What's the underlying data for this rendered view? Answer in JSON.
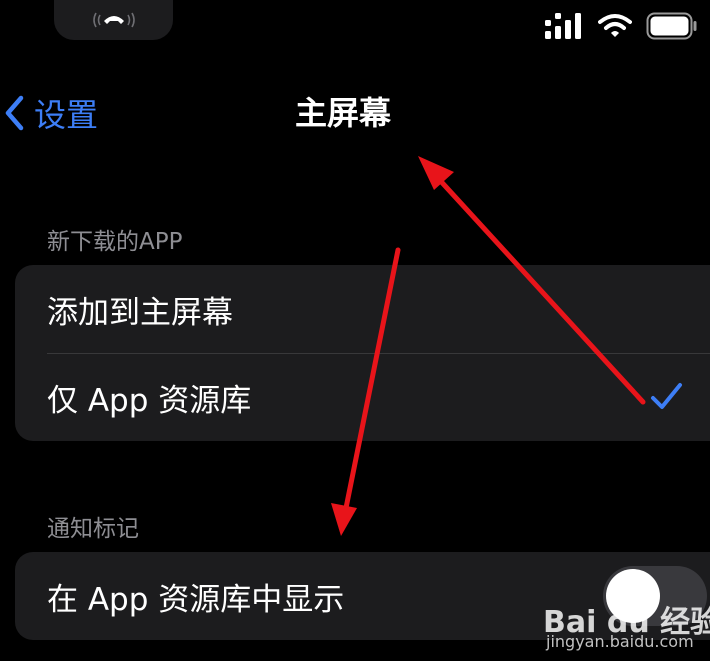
{
  "nav": {
    "back_label": "设置",
    "title": "主屏幕"
  },
  "sections": [
    {
      "header": "新下载的APP",
      "rows": [
        "添加到主屏幕",
        "仅 App 资源库"
      ],
      "selected_index": 1
    },
    {
      "header": "通知标记",
      "rows": [
        "在 App 资源库中显示"
      ],
      "toggle_on": false
    }
  ],
  "icons": [
    "phone-call-icon",
    "cellular-signal-icon",
    "wifi-icon",
    "battery-icon",
    "back-chevron-icon",
    "checkmark-icon"
  ],
  "colors": {
    "accent": "#3d7ef6",
    "annotation": "#e8141a",
    "background": "#000000",
    "group_bg": "#1c1c1e"
  },
  "watermark": {
    "logo": "Bai du 经验",
    "site": "jingyan.baidu.com"
  }
}
